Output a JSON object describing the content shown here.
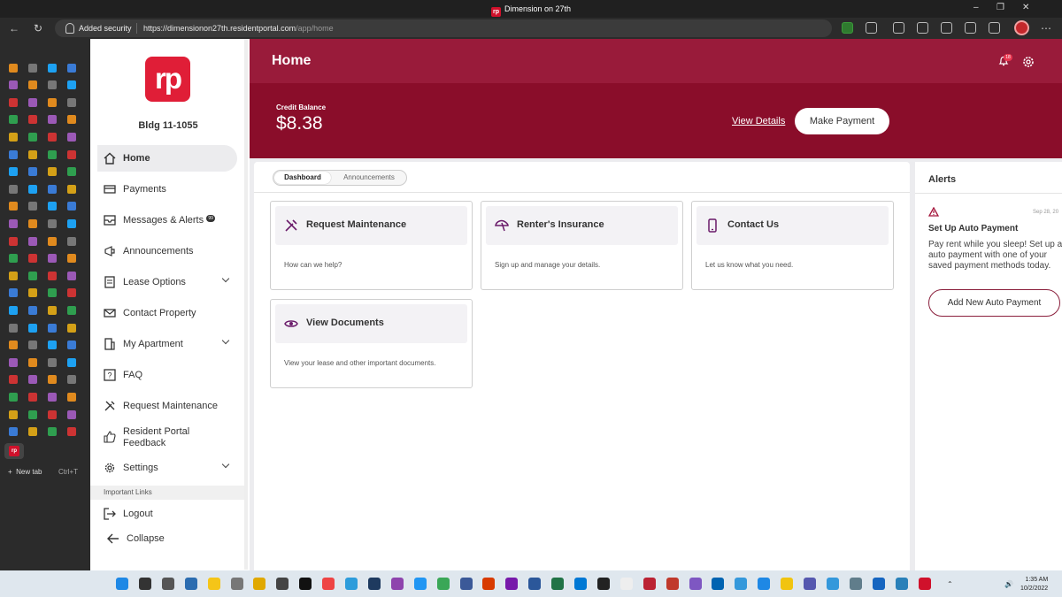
{
  "window": {
    "title": "Dimension on 27th"
  },
  "browser": {
    "security_label": "Added security",
    "url_host": "https://dimensionon27th.residentportal.com",
    "url_path": "/app/home"
  },
  "vertical_tabs": {
    "new_tab_label": "New tab",
    "new_tab_shortcut": "Ctrl+T"
  },
  "sidebar": {
    "logo_text": "rp",
    "building": "Bldg 11-1055",
    "items": [
      {
        "label": "Home",
        "icon": "home-icon",
        "active": true
      },
      {
        "label": "Payments",
        "icon": "card-icon"
      },
      {
        "label": "Messages & Alerts",
        "icon": "inbox-icon",
        "badge": "99"
      },
      {
        "label": "Announcements",
        "icon": "megaphone-icon"
      },
      {
        "label": "Lease Options",
        "icon": "lease-icon",
        "expandable": true
      },
      {
        "label": "Contact Property",
        "icon": "mail-icon"
      },
      {
        "label": "My Apartment",
        "icon": "building-icon",
        "expandable": true
      },
      {
        "label": "FAQ",
        "icon": "question-icon"
      },
      {
        "label": "Request Maintenance",
        "icon": "tools-icon"
      },
      {
        "label": "Resident Portal Feedback",
        "icon": "thumbs-up-icon"
      },
      {
        "label": "Settings",
        "icon": "gear-icon",
        "expandable": true
      }
    ],
    "important_links": "Important Links",
    "logout": "Logout",
    "collapse": "Collapse"
  },
  "header": {
    "title": "Home",
    "notification_count": "18"
  },
  "balance": {
    "label": "Credit Balance",
    "amount": "$8.38",
    "view_details": "View Details",
    "make_payment": "Make Payment"
  },
  "tabs": [
    "Dashboard",
    "Announcements"
  ],
  "cards": [
    {
      "title": "Request Maintenance",
      "desc": "How can we help?",
      "icon": "tools-icon"
    },
    {
      "title": "Renter's Insurance",
      "desc": "Sign up and manage your details.",
      "icon": "umbrella-icon"
    },
    {
      "title": "Contact Us",
      "desc": "Let us know what you need.",
      "icon": "phone-icon"
    },
    {
      "title": "View Documents",
      "desc": "View your lease and other important documents.",
      "icon": "eye-icon"
    }
  ],
  "alerts": {
    "heading": "Alerts",
    "date": "Sep 28, 20",
    "title": "Set Up Auto Payment",
    "body": "Pay rent while you sleep! Set up an auto payment with one of your saved payment methods today.",
    "button": "Add New Auto Payment"
  },
  "taskbar": {
    "time": "1:35 AM",
    "date": "10/2/2022",
    "mail_badge": "54"
  },
  "colors": {
    "brand": "#991b3a",
    "brand_dark": "#8a0d2a",
    "logo": "#e01e37"
  }
}
